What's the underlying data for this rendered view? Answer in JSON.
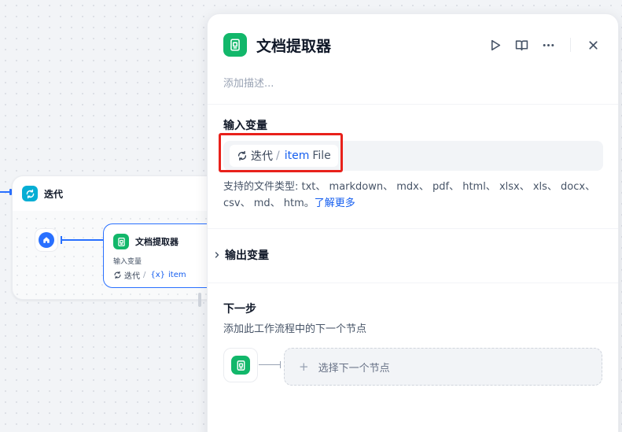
{
  "canvas": {
    "iteration_node": {
      "title": "迭代"
    },
    "doc_node": {
      "title": "文档提取器",
      "input_label": "输入变量",
      "chip": {
        "source": "迭代",
        "separator": "/",
        "var_prefix": "{x}",
        "var_name": "item"
      }
    }
  },
  "panel": {
    "title": "文档提取器",
    "description_placeholder": "添加描述...",
    "input_section": {
      "title": "输入变量",
      "chip": {
        "source": "迭代",
        "separator": "/",
        "var_name": "item",
        "type": "File"
      },
      "supported_text": "支持的文件类型: txt、 markdown、 mdx、 pdf、 html、 xlsx、 xls、 docx、 csv、 md、 htm。",
      "learn_more": "了解更多"
    },
    "output_section": {
      "title": "输出变量"
    },
    "next_section": {
      "title": "下一步",
      "subtitle": "添加此工作流程中的下一个节点",
      "select_label": "选择下一个节点",
      "plus": "+"
    }
  },
  "icons": {
    "iteration": "refresh-icon",
    "document": "document-extractor-icon",
    "start": "home-icon",
    "run": "play-icon",
    "docs": "book-open-icon",
    "more": "more-dots-icon",
    "close": "close-icon",
    "chevron": "chevron-right-icon"
  },
  "colors": {
    "accent_blue": "#2970ff",
    "link_blue": "#155eef",
    "iteration_cyan": "#06aed4",
    "doc_green": "#12b76a",
    "highlight_red": "#e8211b"
  }
}
